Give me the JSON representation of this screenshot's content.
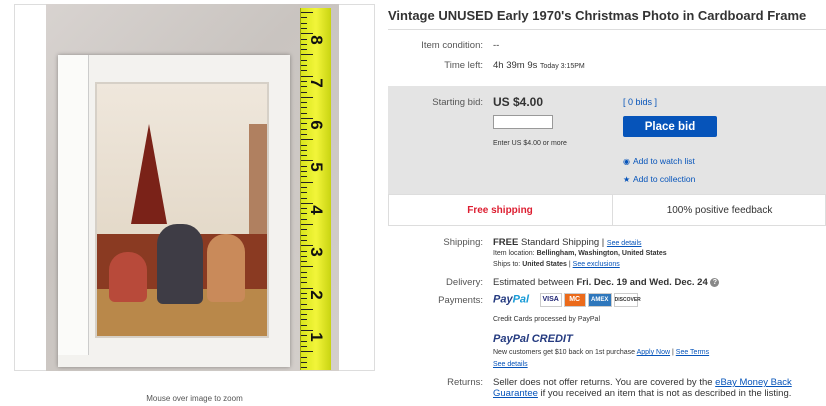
{
  "listing": {
    "title": "Vintage UNUSED Early 1970's Christmas Photo in Cardboard Frame",
    "zoom_hint": "Mouse over image to zoom",
    "tape_numbers": [
      "8",
      "7",
      "6",
      "5",
      "4",
      "3",
      "2",
      "1"
    ]
  },
  "details": {
    "condition_label": "Item condition:",
    "condition_value": "--",
    "time_label": "Time left:",
    "time_value": "4h 39m 9s",
    "time_today": "Today 3:15PM"
  },
  "bidding": {
    "starting_label": "Starting bid:",
    "price": "US $4.00",
    "bids_link": "[ 0 bids ]",
    "input_value": "",
    "enter_hint": "Enter US $4.00 or more",
    "place_bid": "Place bid",
    "watch_link": "Add to watch list",
    "collection_link": "Add to collection"
  },
  "highlights": {
    "free_shipping": "Free shipping",
    "feedback": "100% positive feedback"
  },
  "shipping": {
    "label": "Shipping:",
    "free": "FREE",
    "method": "Standard Shipping",
    "see_details": "See details",
    "location_label": "Item location:",
    "location_value": "Bellingham, Washington, United States",
    "ships_label": "Ships to:",
    "ships_value": "United States",
    "see_exclusions": "See exclusions"
  },
  "delivery": {
    "label": "Delivery:",
    "prefix": "Estimated between",
    "dates": "Fri. Dec. 19 and Wed. Dec. 24",
    "help": "?"
  },
  "payments": {
    "label": "Payments:",
    "paypal_a": "Pay",
    "paypal_b": "Pal",
    "cards": [
      "VISA",
      "MC",
      "AMEX",
      "DISCOVER"
    ],
    "processed": "Credit Cards processed by PayPal",
    "credit_a": "PayPal",
    "credit_b": "CREDIT",
    "credit_offer": "New customers get $10 back on 1st purchase",
    "apply_now": "Apply Now",
    "see_terms": "See Terms",
    "see_details": "See details"
  },
  "returns": {
    "label": "Returns:",
    "text_a": "Seller does not offer returns. You are covered by the",
    "guarantee": "eBay Money Back Guarantee",
    "text_b": "if you received an item that is not as described in the listing."
  },
  "colors": {
    "link": "#0654ba",
    "free_shipping": "#dd1e31",
    "bid_box": "#e4e4e4"
  }
}
